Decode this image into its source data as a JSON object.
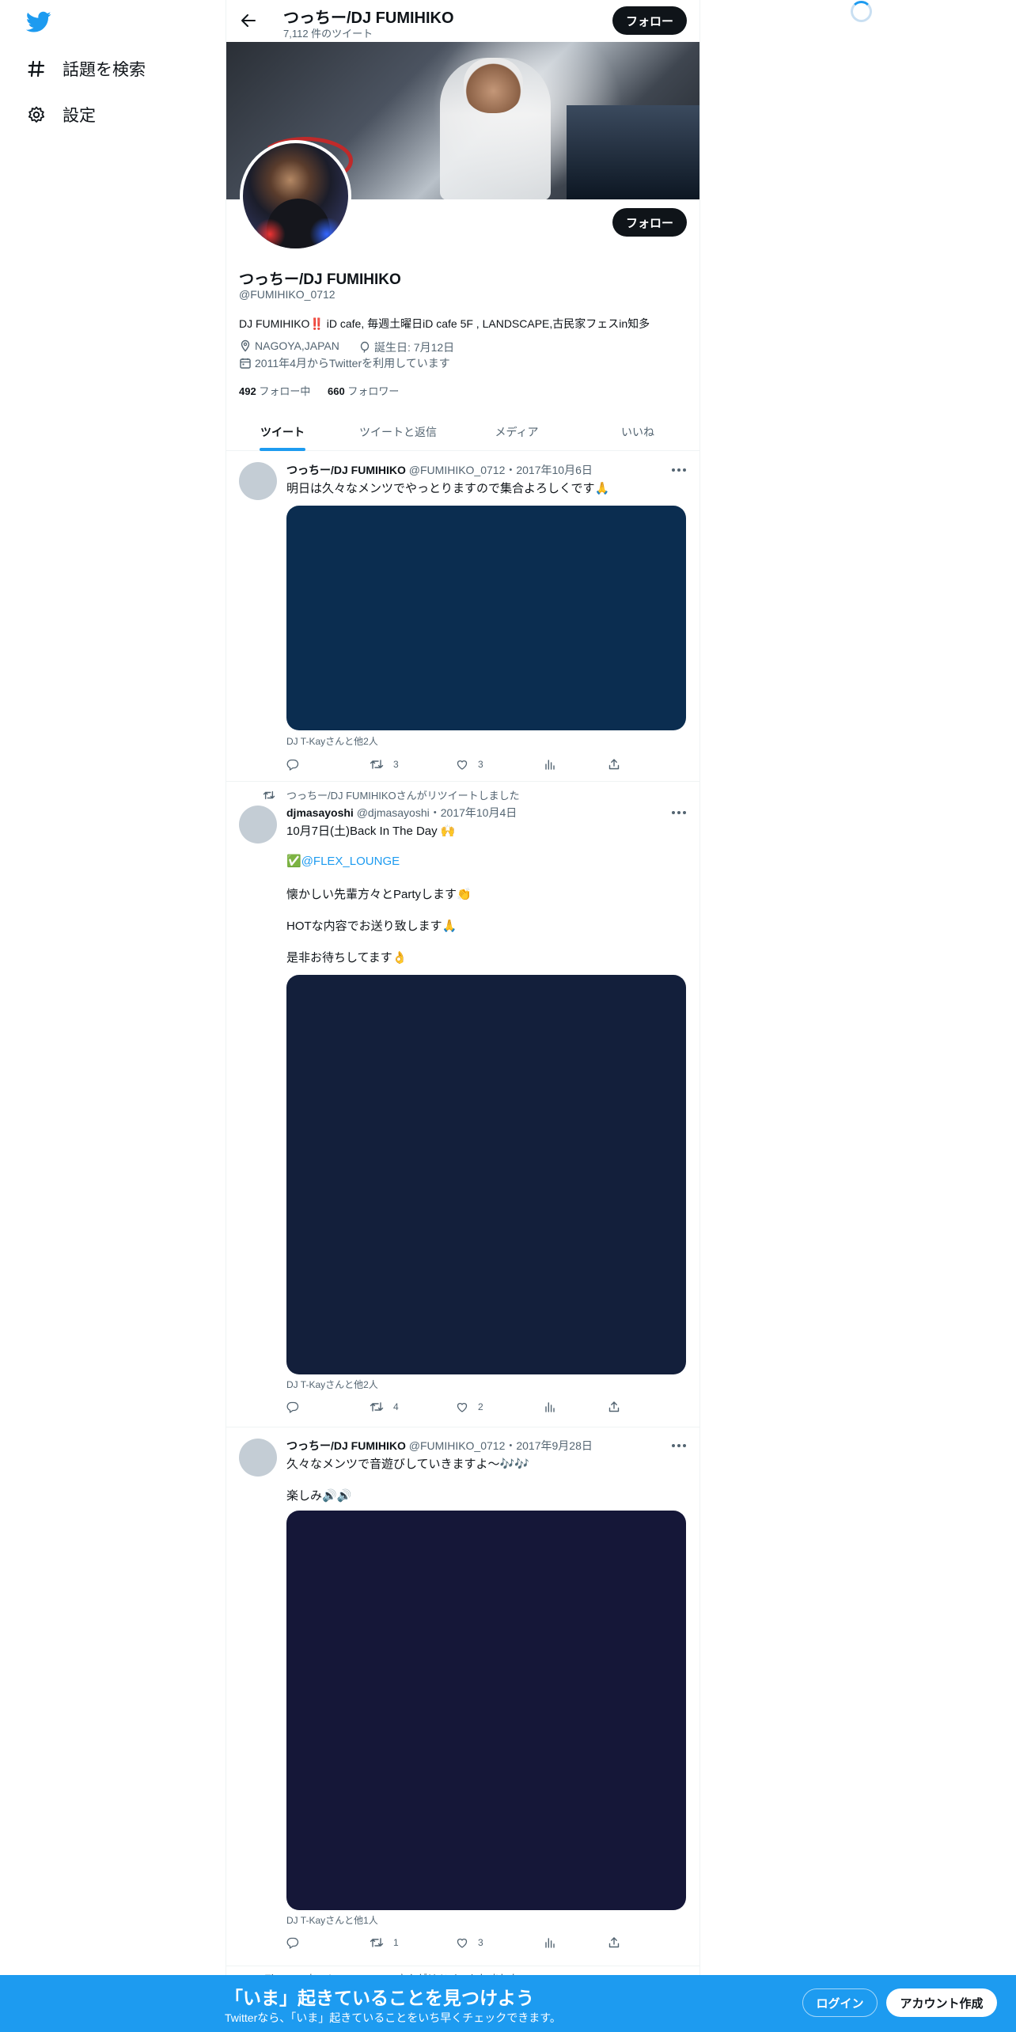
{
  "nav": {
    "items": [
      {
        "label": "話題を検索",
        "icon": "hashtag-icon"
      },
      {
        "label": "設定",
        "icon": "gear-icon"
      }
    ]
  },
  "header": {
    "name": "つっちー/DJ FUMIHIKO",
    "tweet_count": "7,112 件のツイート",
    "follow_label": "フォロー"
  },
  "profile": {
    "name": "つっちー/DJ FUMIHIKO",
    "handle": "@FUMIHIKO_0712",
    "bio": "DJ FUMIHIKO‼️ iD cafe, 毎週土曜日iD cafe 5F , LANDSCAPE,古民家フェスin知多",
    "location": "NAGOYA,JAPAN",
    "birthday": "誕生日: 7月12日",
    "joined": "2011年4月からTwitterを利用しています",
    "following_count": "492",
    "following_label": "フォロー中",
    "followers_count": "660",
    "followers_label": "フォロワー",
    "follow_label": "フォロー"
  },
  "tabs": [
    "ツイート",
    "ツイートと返信",
    "メディア",
    "いいね"
  ],
  "tweets": [
    {
      "name": "つっちー/DJ FUMIHIKO",
      "handle_date": "@FUMIHIKO_0712・2017年10月6日",
      "text": [
        "明日は久々なメンツでやっとりますので集合よろしくです🙏"
      ],
      "media_color": "#0b2d50",
      "tagged": "DJ T-Kayさんと他2人",
      "retweets": "3",
      "likes": "3"
    },
    {
      "retweet_note": "つっちー/DJ FUMIHIKOさんがリツイートしました",
      "name": "djmasayoshi",
      "handle_date": "@djmasayoshi・2017年10月4日",
      "text": [
        "10月7日(土)Back In The Day 🙌",
        "✅",
        "@FLEX_LOUNGE",
        "懐かしい先輩方々とPartyします👏",
        "HOTな内容でお送り致します🙏",
        "是非お待ちしてます👌"
      ],
      "media_color": "#131f3b",
      "tagged": "DJ T-Kayさんと他2人",
      "retweets": "4",
      "likes": "2"
    },
    {
      "name": "つっちー/DJ FUMIHIKO",
      "handle_date": "@FUMIHIKO_0712・2017年9月28日",
      "text": [
        "久々なメンツで音遊びしていきますよ〜🎶🎶",
        "楽しみ🔊🔊"
      ],
      "media_color": "#151738",
      "tagged": "DJ T-Kayさんと他1人",
      "retweets": "1",
      "likes": "3"
    },
    {
      "retweet_note": "つっちー/DJ FUMIHIKOさんがリツイートしました"
    }
  ],
  "bottom_bar": {
    "title": "「いま」起きていることを見つけよう",
    "subtitle": "Twitterなら、「いま」起きていることをいち早くチェックできます。",
    "login": "ログイン",
    "signup": "アカウント作成"
  },
  "colors": {
    "accent": "#1d9bf0",
    "text": "#0f1419",
    "muted": "#536471"
  }
}
